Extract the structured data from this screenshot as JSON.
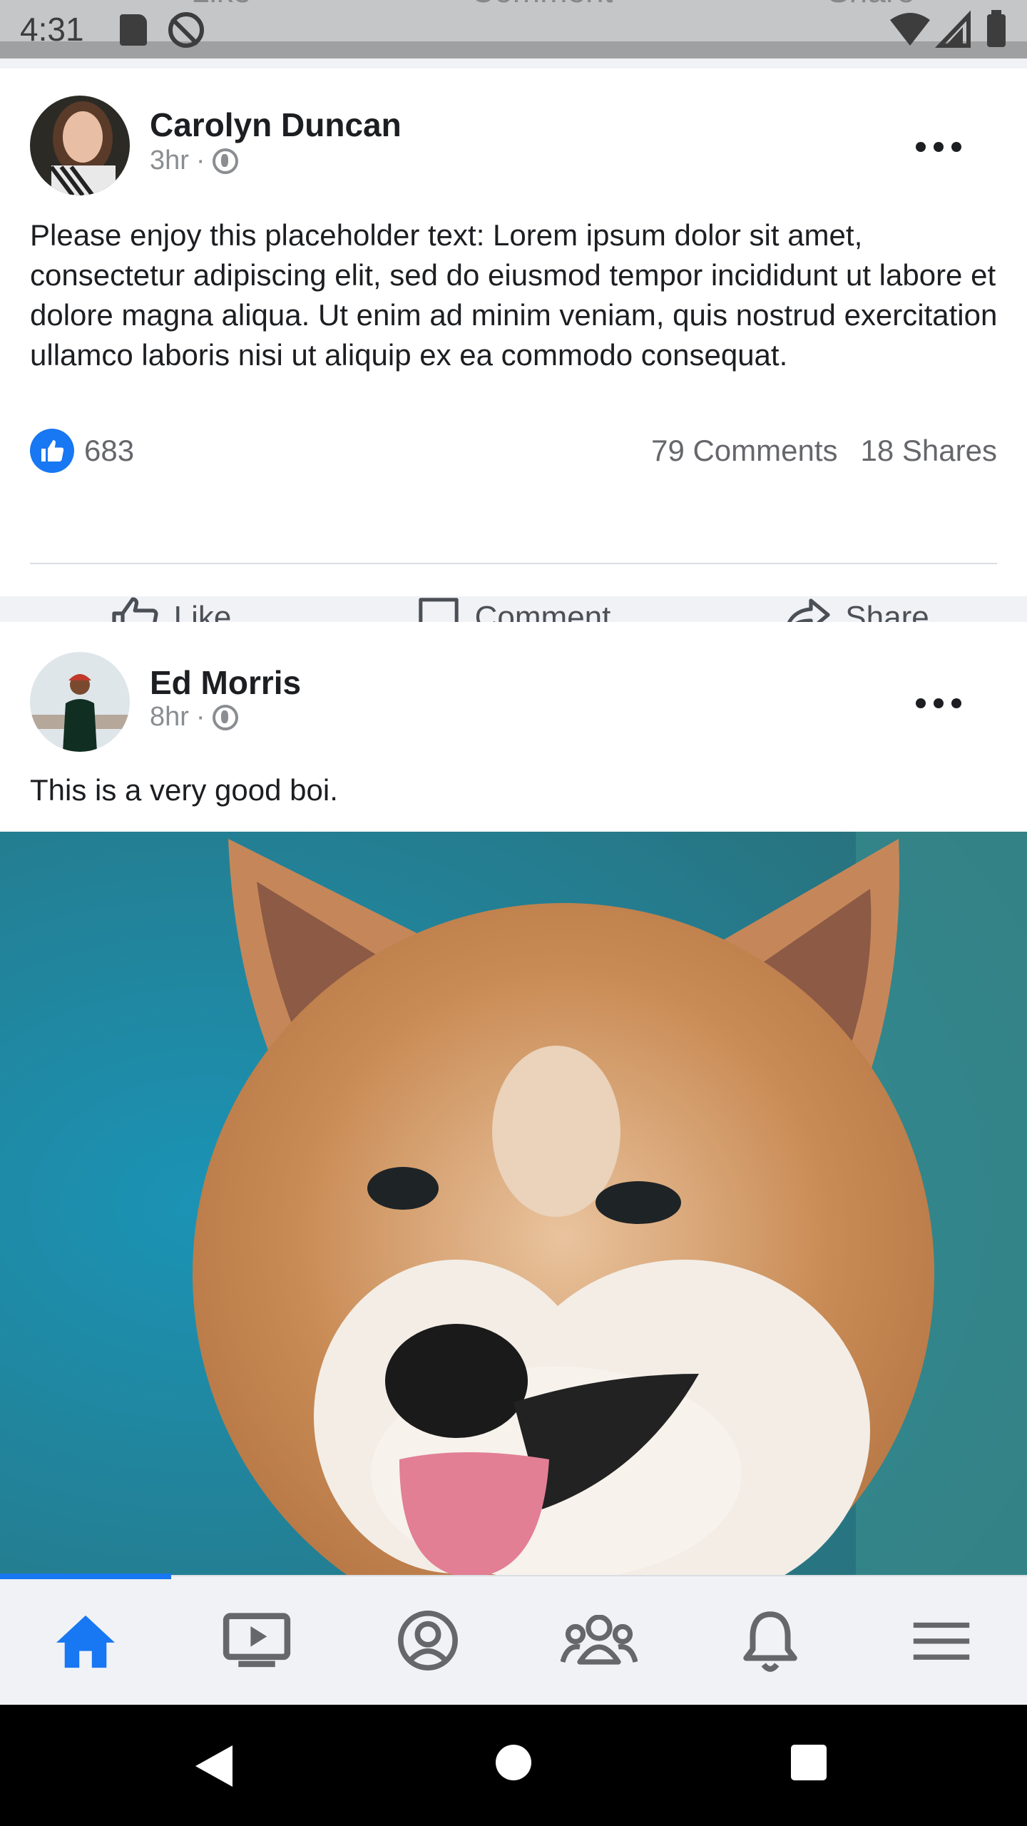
{
  "status_bar": {
    "time": "4:31",
    "ghost_labels": [
      "Like",
      "Comment",
      "Share"
    ]
  },
  "posts": [
    {
      "author": "Carolyn Duncan",
      "time": "3hr",
      "separator": "·",
      "text": "Please enjoy this placeholder text: Lorem ipsum dolor sit amet, consectetur adipiscing elit, sed do eiusmod tempor incididunt ut labore et dolore magna aliqua. Ut enim ad minim veniam, quis nostrud exercitation ullamco laboris nisi ut aliquip ex ea commodo consequat.",
      "likes": "683",
      "comments": "79 Comments",
      "shares": "18 Shares",
      "actions": {
        "like": "Like",
        "comment": "Comment",
        "share": "Share"
      }
    },
    {
      "author": "Ed Morris",
      "time": "8hr",
      "separator": "·",
      "text": "This is a very good boi."
    }
  ],
  "bottom_nav": [
    "home-icon",
    "video-icon",
    "profile-icon",
    "groups-icon",
    "bell-icon",
    "menu-icon"
  ],
  "colors": {
    "accent": "#1877f2",
    "text": "#1c1e21",
    "muted": "#65676b"
  }
}
